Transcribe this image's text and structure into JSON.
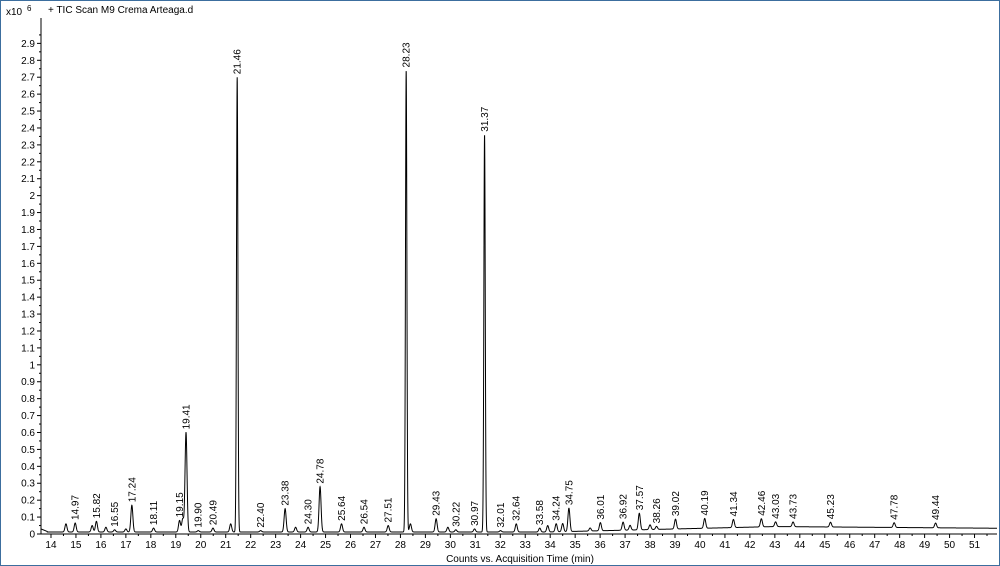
{
  "chart_data": {
    "type": "line",
    "title": "+ TIC Scan M9 Crema Arteaga.d",
    "xlabel": "Counts vs. Acquisition Time (min)",
    "y_multiplier_base": "x10",
    "y_multiplier_exp": "6",
    "xlim": [
      13.6,
      51.9
    ],
    "ylim": [
      0,
      3.05
    ],
    "x_ticks": [
      "14",
      "15",
      "16",
      "17",
      "18",
      "19",
      "20",
      "21",
      "22",
      "23",
      "24",
      "25",
      "26",
      "27",
      "28",
      "29",
      "30",
      "31",
      "32",
      "33",
      "34",
      "35",
      "36",
      "37",
      "38",
      "39",
      "40",
      "41",
      "42",
      "43",
      "44",
      "45",
      "46",
      "47",
      "48",
      "49",
      "50",
      "51"
    ],
    "y_ticks": [
      "0",
      "0.1",
      "0.2",
      "0.3",
      "0.4",
      "0.5",
      "0.6",
      "0.7",
      "0.8",
      "0.9",
      "1",
      "1.1",
      "1.2",
      "1.3",
      "1.4",
      "1.5",
      "1.6",
      "1.7",
      "1.8",
      "1.9",
      "2",
      "2.1",
      "2.2",
      "2.3",
      "2.4",
      "2.5",
      "2.6",
      "2.7",
      "2.8",
      "2.9"
    ],
    "grid": false,
    "series": [
      {
        "peaks": [
          {
            "x": 14.97,
            "y": 0.065,
            "label": "14.97"
          },
          {
            "x": 15.82,
            "y": 0.075,
            "label": "15.82"
          },
          {
            "x": 16.55,
            "y": 0.025,
            "label": "16.55"
          },
          {
            "x": 17.24,
            "y": 0.17,
            "label": "17.24"
          },
          {
            "x": 18.11,
            "y": 0.035,
            "label": "18.11"
          },
          {
            "x": 19.15,
            "y": 0.08,
            "label": "19.15"
          },
          {
            "x": 19.41,
            "y": 0.6,
            "label": "19.41"
          },
          {
            "x": 19.9,
            "y": 0.02,
            "label": "19.90"
          },
          {
            "x": 20.49,
            "y": 0.035,
            "label": "20.49"
          },
          {
            "x": 21.46,
            "y": 2.7,
            "label": "21.46"
          },
          {
            "x": 22.4,
            "y": 0.02,
            "label": "22.40"
          },
          {
            "x": 23.38,
            "y": 0.15,
            "label": "23.38"
          },
          {
            "x": 24.3,
            "y": 0.04,
            "label": "24.30"
          },
          {
            "x": 24.78,
            "y": 0.28,
            "label": "24.78"
          },
          {
            "x": 25.64,
            "y": 0.06,
            "label": "25.64"
          },
          {
            "x": 26.54,
            "y": 0.04,
            "label": "26.54"
          },
          {
            "x": 27.51,
            "y": 0.05,
            "label": "27.51"
          },
          {
            "x": 28.23,
            "y": 2.74,
            "label": "28.23"
          },
          {
            "x": 29.43,
            "y": 0.09,
            "label": "29.43"
          },
          {
            "x": 30.22,
            "y": 0.025,
            "label": "30.22"
          },
          {
            "x": 30.97,
            "y": 0.03,
            "label": "30.97"
          },
          {
            "x": 31.37,
            "y": 2.36,
            "label": "31.37"
          },
          {
            "x": 32.01,
            "y": 0.02,
            "label": "32.01"
          },
          {
            "x": 32.64,
            "y": 0.06,
            "label": "32.64"
          },
          {
            "x": 33.58,
            "y": 0.035,
            "label": "33.58"
          },
          {
            "x": 34.24,
            "y": 0.06,
            "label": "34.24"
          },
          {
            "x": 34.75,
            "y": 0.15,
            "label": "34.75"
          },
          {
            "x": 36.01,
            "y": 0.06,
            "label": "36.01"
          },
          {
            "x": 36.92,
            "y": 0.06,
            "label": "36.92"
          },
          {
            "x": 37.57,
            "y": 0.11,
            "label": "37.57"
          },
          {
            "x": 38.26,
            "y": 0.03,
            "label": "38.26"
          },
          {
            "x": 39.02,
            "y": 0.07,
            "label": "39.02"
          },
          {
            "x": 40.19,
            "y": 0.07,
            "label": "40.19"
          },
          {
            "x": 41.34,
            "y": 0.06,
            "label": "41.34"
          },
          {
            "x": 42.46,
            "y": 0.06,
            "label": "42.46"
          },
          {
            "x": 43.03,
            "y": 0.04,
            "label": "43.03"
          },
          {
            "x": 43.73,
            "y": 0.04,
            "label": "43.73"
          },
          {
            "x": 45.23,
            "y": 0.04,
            "label": "45.23"
          },
          {
            "x": 47.78,
            "y": 0.04,
            "label": "47.78"
          },
          {
            "x": 49.44,
            "y": 0.04,
            "label": "49.44"
          }
        ],
        "unlabeled_peaks": [
          {
            "x": 14.6,
            "y": 0.06
          },
          {
            "x": 15.65,
            "y": 0.05
          },
          {
            "x": 16.2,
            "y": 0.04
          },
          {
            "x": 17.0,
            "y": 0.03
          },
          {
            "x": 19.28,
            "y": 0.09
          },
          {
            "x": 21.2,
            "y": 0.06
          },
          {
            "x": 23.8,
            "y": 0.04
          },
          {
            "x": 28.4,
            "y": 0.06
          },
          {
            "x": 29.9,
            "y": 0.04
          },
          {
            "x": 33.9,
            "y": 0.05
          },
          {
            "x": 34.5,
            "y": 0.06
          },
          {
            "x": 35.6,
            "y": 0.03
          },
          {
            "x": 37.2,
            "y": 0.04
          },
          {
            "x": 38.0,
            "y": 0.04
          }
        ]
      }
    ],
    "colors": {
      "line": "#000000",
      "frame": "#000000",
      "background": "#ffffff",
      "outer_border": "#3c6e9e"
    }
  }
}
